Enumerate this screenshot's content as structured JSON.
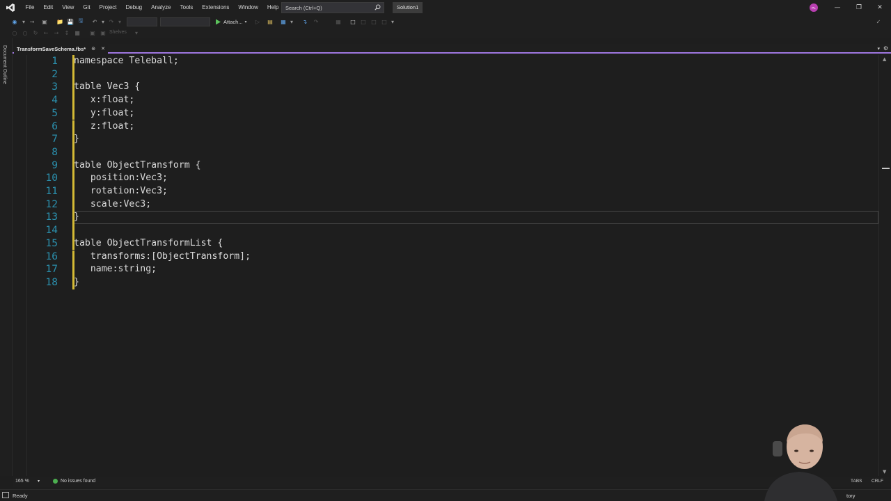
{
  "menu": {
    "items": [
      "File",
      "Edit",
      "View",
      "Git",
      "Project",
      "Debug",
      "Analyze",
      "Tools",
      "Extensions",
      "Window",
      "Help"
    ]
  },
  "search": {
    "placeholder": "Search (Ctrl+Q)"
  },
  "solution": {
    "name": "Solution1"
  },
  "user": {
    "initials": "PL",
    "color": "#b83fb0"
  },
  "toolbar": {
    "attach_label": "Attach...",
    "shelves_label": "Shelves"
  },
  "side_panel": {
    "label": "Document Outline"
  },
  "tab": {
    "filename": "TransformSaveSchema.fbs*"
  },
  "editor": {
    "accent_color": "#9e76e0",
    "lines": [
      {
        "num": "1",
        "text": "namespace Teleball;"
      },
      {
        "num": "2",
        "text": ""
      },
      {
        "num": "3",
        "text": "table Vec3 {"
      },
      {
        "num": "4",
        "text": "   x:float;"
      },
      {
        "num": "5",
        "text": "   y:float;"
      },
      {
        "num": "6",
        "text": "   z:float;"
      },
      {
        "num": "7",
        "text": "}"
      },
      {
        "num": "8",
        "text": ""
      },
      {
        "num": "9",
        "text": "table ObjectTransform {"
      },
      {
        "num": "10",
        "text": "   position:Vec3;"
      },
      {
        "num": "11",
        "text": "   rotation:Vec3;"
      },
      {
        "num": "12",
        "text": "   scale:Vec3;"
      },
      {
        "num": "13",
        "text": "}"
      },
      {
        "num": "14",
        "text": ""
      },
      {
        "num": "15",
        "text": "table ObjectTransformList {"
      },
      {
        "num": "16",
        "text": "   transforms:[ObjectTransform];"
      },
      {
        "num": "17",
        "text": "   name:string;"
      },
      {
        "num": "18",
        "text": "}"
      }
    ],
    "current_line": "13"
  },
  "editor_status": {
    "zoom": "165 %",
    "issues": "No issues found",
    "indent": "TABS",
    "line_ending": "CRLF"
  },
  "statusbar": {
    "state": "Ready",
    "repo": "tory"
  }
}
